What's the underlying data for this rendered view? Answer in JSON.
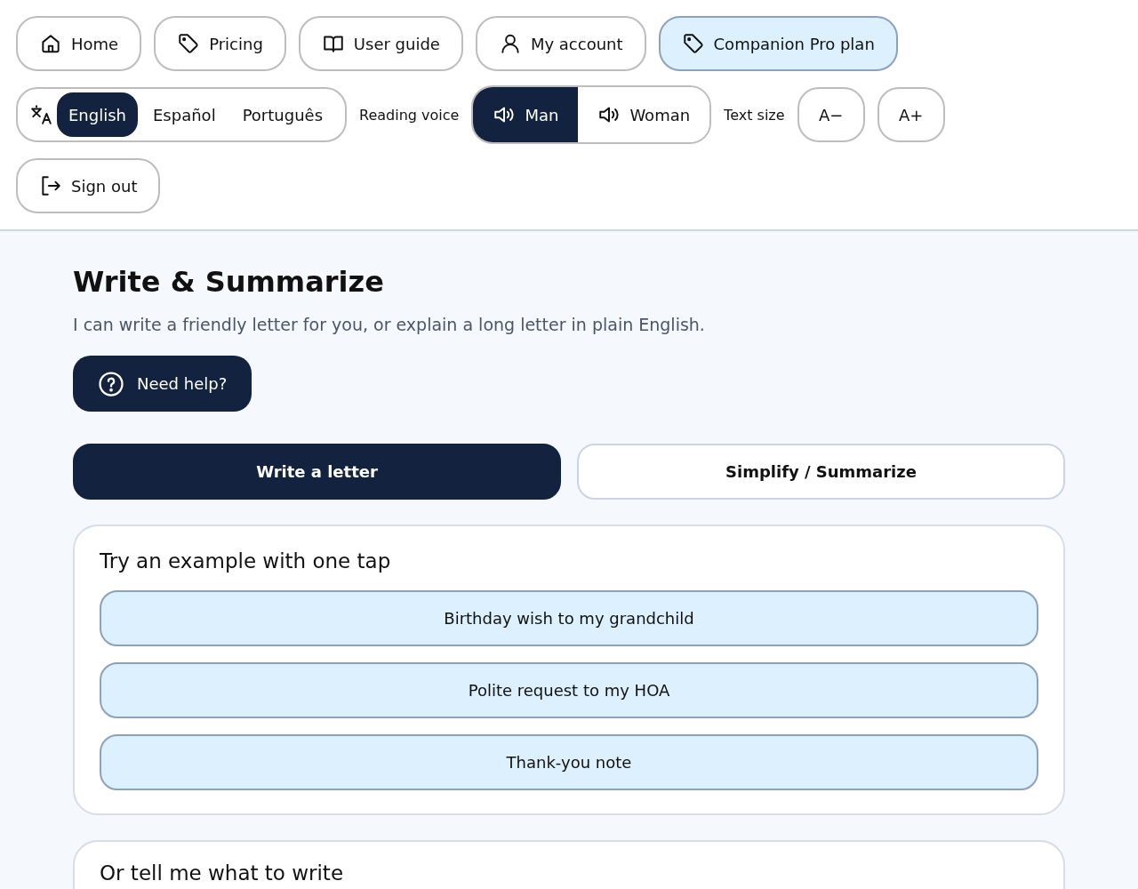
{
  "nav": [
    {
      "label": "Home",
      "highlighted": false
    },
    {
      "label": "Pricing",
      "highlighted": false
    },
    {
      "label": "User guide",
      "highlighted": false
    },
    {
      "label": "My account",
      "highlighted": false
    },
    {
      "label": "Companion Pro plan",
      "highlighted": true
    }
  ],
  "languages": [
    {
      "label": "English",
      "selected": true
    },
    {
      "label": "Español",
      "selected": false
    },
    {
      "label": "Português",
      "selected": false
    }
  ],
  "reading_voice": {
    "label": "Reading voice",
    "options": [
      {
        "label": "Man",
        "selected": true
      },
      {
        "label": "Woman",
        "selected": false
      }
    ]
  },
  "text_size": {
    "label": "Text size",
    "buttons": [
      "A−",
      "A+"
    ]
  },
  "sign_out": "Sign out",
  "page": {
    "title": "Write & Summarize",
    "subtitle": "I can write a friendly letter for you, or explain a long letter in plain English.",
    "help_button": "Need help?"
  },
  "modes": [
    {
      "label": "Write a letter",
      "selected": true
    },
    {
      "label": "Simplify / Summarize",
      "selected": false
    }
  ],
  "examples_card": {
    "title": "Try an example with one tap",
    "examples": [
      "Birthday wish to my grandchild",
      "Polite request to my HOA",
      "Thank-you note"
    ]
  },
  "custom_card": {
    "title": "Or tell me what to write"
  }
}
